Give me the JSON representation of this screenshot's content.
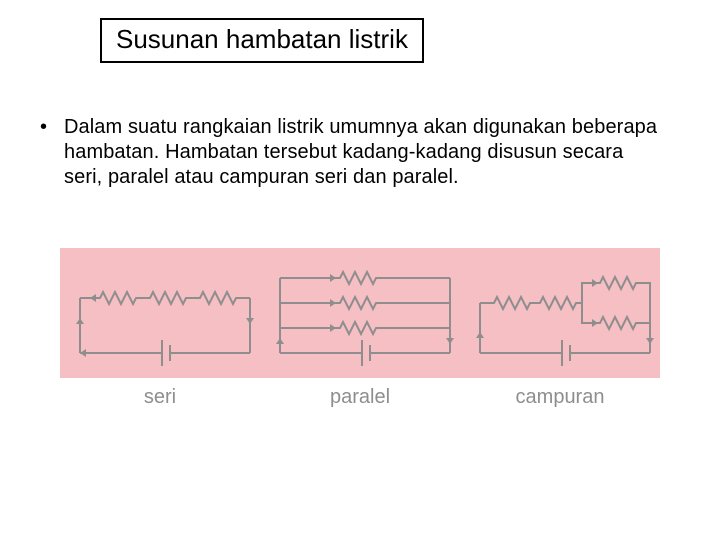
{
  "title": "Susunan hambatan listrik",
  "bullet": {
    "mark": "•",
    "text": "Dalam suatu rangkaian listrik umumnya akan digunakan beberapa hambatan. Hambatan tersebut kadang-kadang disusun secara seri, paralel atau campuran seri dan paralel."
  },
  "diagram": {
    "captions": [
      "seri",
      "paralel",
      "campuran"
    ]
  }
}
